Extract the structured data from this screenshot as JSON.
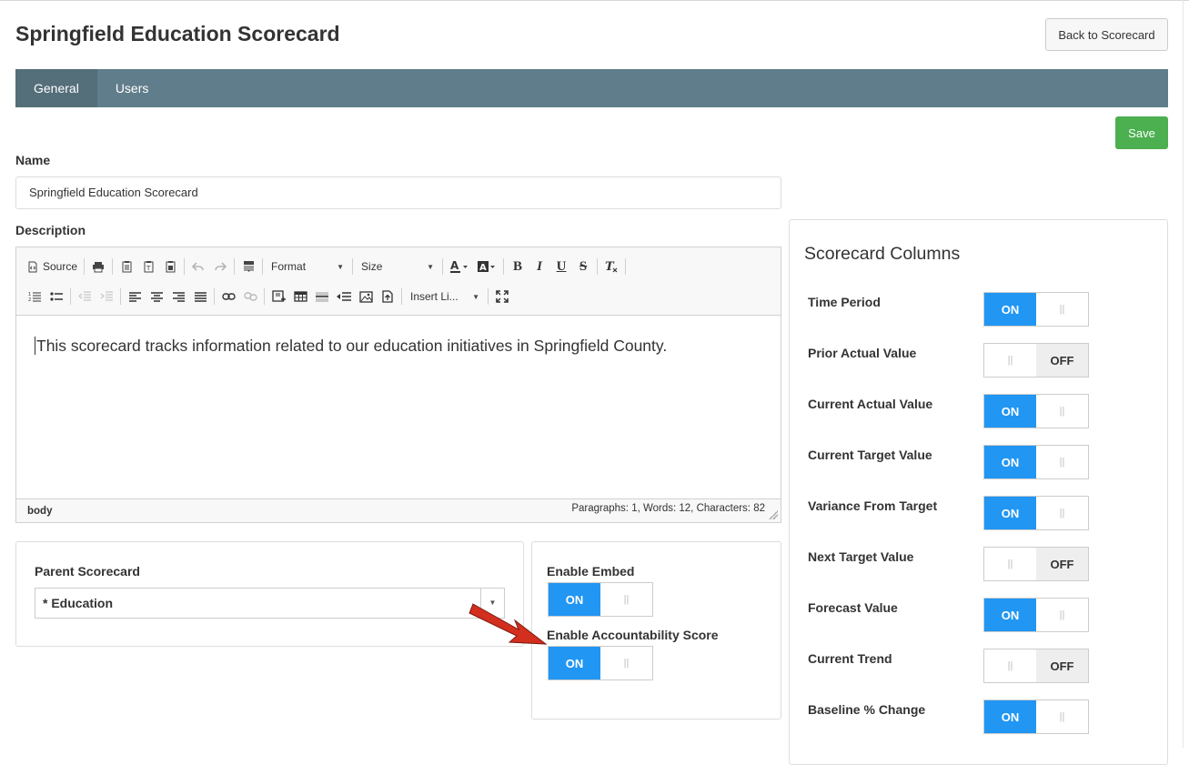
{
  "page": {
    "title": "Springfield Education Scorecard",
    "back_label": "Back to Scorecard"
  },
  "tabs": [
    {
      "label": "General",
      "active": true
    },
    {
      "label": "Users",
      "active": false
    }
  ],
  "save_label": "Save",
  "form": {
    "name_label": "Name",
    "name_value": "Springfield Education Scorecard",
    "description_label": "Description"
  },
  "editor": {
    "toolbar": {
      "source_label": "Source",
      "format_label": "Format",
      "size_label": "Size",
      "insert_label": "Insert Li..."
    },
    "content": "This scorecard tracks information related to our education initiatives in Springfield County.",
    "status_path": "body",
    "status_counts": "Paragraphs: 1, Words: 12, Characters: 82"
  },
  "parent": {
    "label": "Parent Scorecard",
    "value": "* Education"
  },
  "embed": {
    "enable_embed_label": "Enable Embed",
    "enable_embed_state": "ON",
    "accountability_label": "Enable Accountability Score",
    "accountability_state": "ON"
  },
  "scorecard_columns": {
    "title": "Scorecard Columns",
    "items": [
      {
        "label": "Time Period",
        "state": "ON"
      },
      {
        "label": "Prior Actual Value",
        "state": "OFF"
      },
      {
        "label": "Current Actual Value",
        "state": "ON"
      },
      {
        "label": "Current Target Value",
        "state": "ON"
      },
      {
        "label": "Variance From Target",
        "state": "ON"
      },
      {
        "label": "Next Target Value",
        "state": "OFF"
      },
      {
        "label": "Forecast Value",
        "state": "ON"
      },
      {
        "label": "Current Trend",
        "state": "OFF"
      },
      {
        "label": "Baseline % Change",
        "state": "ON"
      }
    ]
  },
  "toggle_grip": "||",
  "colors": {
    "tabbar": "#607d8b",
    "tab_active": "#546e7a",
    "save": "#4caf50",
    "toggle_on": "#2196f3",
    "annotation_arrow": "#d32f1e"
  }
}
